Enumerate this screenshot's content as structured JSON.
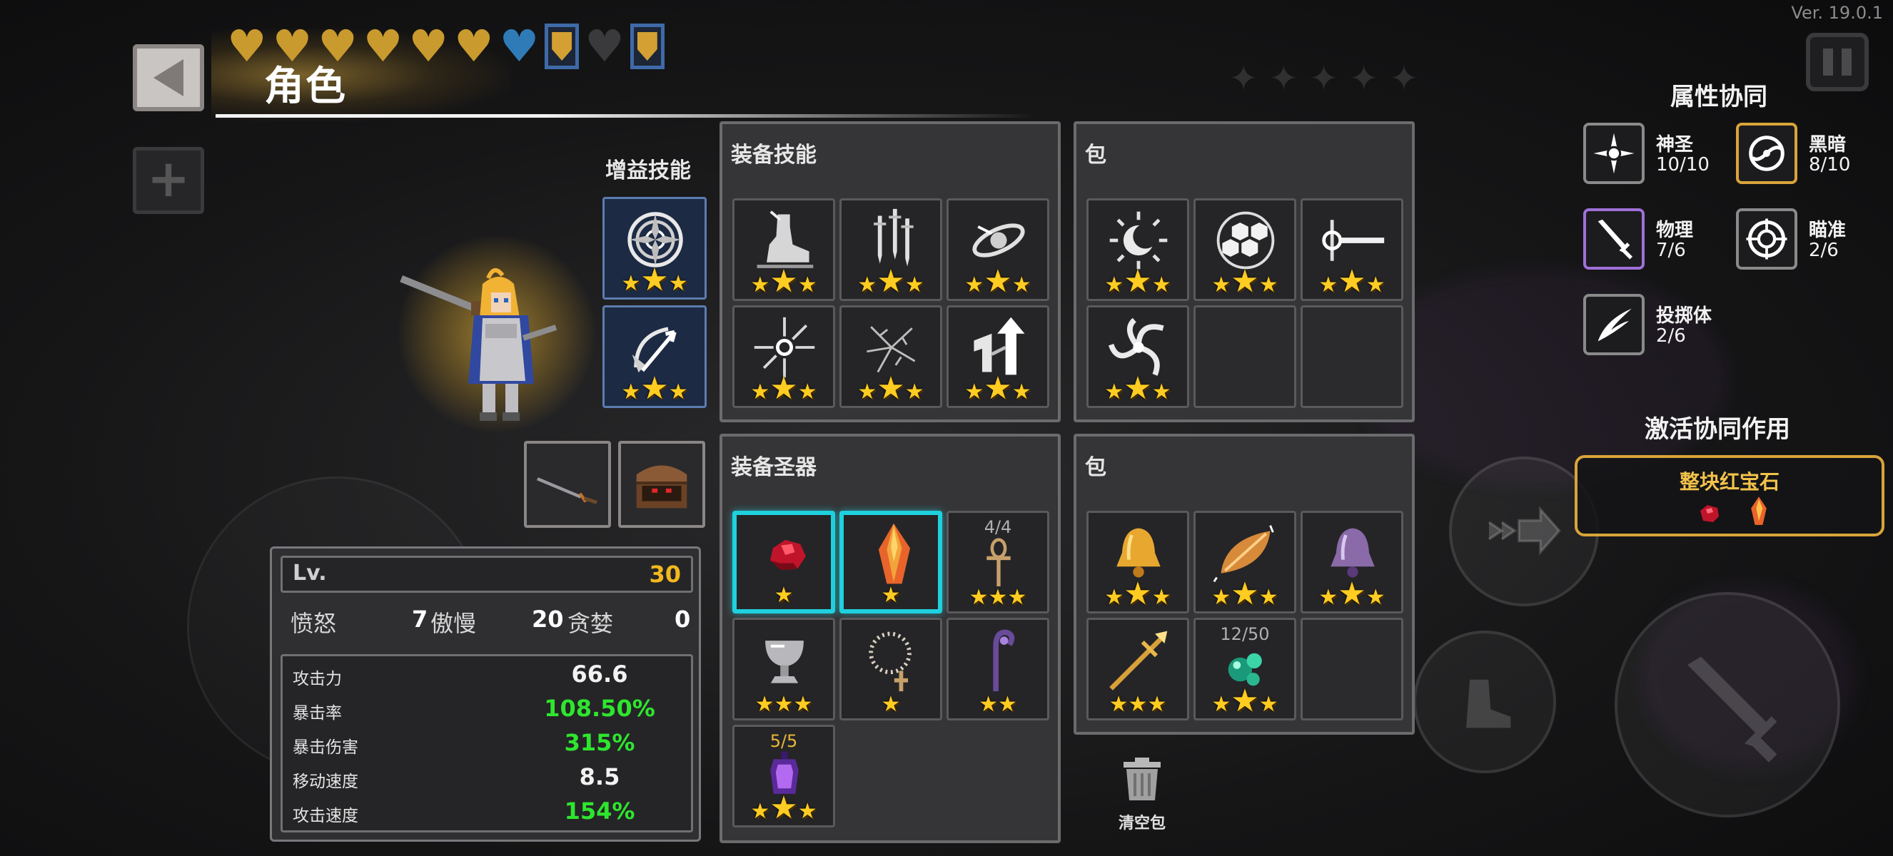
{
  "header": {
    "title": "角色",
    "version": "Ver. 19.0.1",
    "hearts": [
      {
        "type": "gold",
        "color": "#c99a2e"
      },
      {
        "type": "gold",
        "color": "#c99a2e"
      },
      {
        "type": "gold",
        "color": "#c99a2e"
      },
      {
        "type": "gold",
        "color": "#c99a2e"
      },
      {
        "type": "gold",
        "color": "#c99a2e"
      },
      {
        "type": "gold",
        "color": "#c99a2e"
      },
      {
        "type": "blue",
        "color": "#2f7bb8"
      },
      {
        "type": "shield"
      },
      {
        "type": "dark",
        "color": "#3a3a3c"
      },
      {
        "type": "shield"
      }
    ]
  },
  "buff_skills": {
    "label": "增益技能",
    "slots": [
      {
        "icon": "mandala-icon",
        "stars": 3
      },
      {
        "icon": "arrow-bow-icon",
        "stars": 3
      }
    ]
  },
  "character": {
    "name_icon": "knight-hero",
    "weapons": [
      "sword-weapon-icon",
      "treasure-chest-icon"
    ]
  },
  "stats": {
    "level_label": "Lv.",
    "level_value": "30",
    "sins": [
      {
        "label": "愤怒",
        "value": "7"
      },
      {
        "label": "傲慢",
        "value": "20"
      },
      {
        "label": "贪婪",
        "value": "0"
      }
    ],
    "attributes": [
      {
        "label": "攻击力",
        "value": "66.6",
        "tone": "white"
      },
      {
        "label": "暴击率",
        "value": "108.50%",
        "tone": "green"
      },
      {
        "label": "暴击伤害",
        "value": "315%",
        "tone": "green"
      },
      {
        "label": "移动速度",
        "value": "8.5",
        "tone": "white"
      },
      {
        "label": "攻击速度",
        "value": "154%",
        "tone": "green"
      }
    ]
  },
  "equip_skills": {
    "title": "装备技能",
    "slots": [
      {
        "icon": "boot-stomp-icon",
        "stars": 3
      },
      {
        "icon": "triple-daggers-icon",
        "stars": 3
      },
      {
        "icon": "orbit-disc-icon",
        "stars": 3
      },
      {
        "icon": "spark-burst-icon",
        "stars": 3
      },
      {
        "icon": "crack-icon",
        "stars": 3
      },
      {
        "icon": "rising-arrows-icon",
        "stars": 3
      }
    ]
  },
  "skill_bag": {
    "title": "包",
    "slots": [
      {
        "icon": "sun-moon-icon",
        "stars": 3
      },
      {
        "icon": "hexagon-shield-icon",
        "stars": 3
      },
      {
        "icon": "lance-icon",
        "stars": 3
      },
      {
        "icon": "whirlwind-icon",
        "stars": 3
      },
      {
        "icon": "",
        "stars": 0
      },
      {
        "icon": "",
        "stars": 0
      }
    ]
  },
  "equip_relics": {
    "title": "装备圣器",
    "slots": [
      {
        "icon": "ruby-chunk-icon",
        "stars": 1,
        "highlight": true,
        "count": ""
      },
      {
        "icon": "amber-crystal-icon",
        "stars": 1,
        "highlight": true,
        "count": ""
      },
      {
        "icon": "ankh-icon",
        "stars": 3,
        "highlight": false,
        "count": "4/4"
      },
      {
        "icon": "chalice-icon",
        "stars": 3,
        "highlight": false,
        "count": ""
      },
      {
        "icon": "rosary-icon",
        "stars": 1,
        "highlight": false,
        "count": ""
      },
      {
        "icon": "crook-staff-icon",
        "stars": 2,
        "highlight": false,
        "count": ""
      },
      {
        "icon": "purple-lantern-icon",
        "stars": 3,
        "highlight": false,
        "count": "5/5"
      }
    ]
  },
  "relic_bag": {
    "title": "包",
    "slots": [
      {
        "icon": "golden-bell-icon",
        "stars": 3,
        "count": ""
      },
      {
        "icon": "amber-leaf-icon",
        "stars": 3,
        "count": ""
      },
      {
        "icon": "silver-bell-icon",
        "stars": 3,
        "count": ""
      },
      {
        "icon": "golden-spear-icon",
        "stars": 3,
        "count": ""
      },
      {
        "icon": "green-orbs-icon",
        "stars": 3,
        "count": "12/50"
      },
      {
        "icon": "",
        "stars": 0,
        "count": ""
      }
    ]
  },
  "trash": {
    "label": "清空包"
  },
  "synergy": {
    "title": "属性协同",
    "items": [
      {
        "name": "神圣",
        "count": "10/10",
        "icon": "holy-star-icon",
        "accent": "#8a8a8a"
      },
      {
        "name": "黑暗",
        "count": "8/10",
        "icon": "dark-vortex-icon",
        "accent": "#d9a43a"
      },
      {
        "name": "物理",
        "count": "7/6",
        "icon": "physical-sword-icon",
        "accent": "#a070d8"
      },
      {
        "name": "瞄准",
        "count": "2/6",
        "icon": "crosshair-icon",
        "accent": "#8a8a8a"
      },
      {
        "name": "投掷体",
        "count": "2/6",
        "icon": "projectile-slash-icon",
        "accent": "#8a8a8a"
      }
    ],
    "activate_title": "激活协同作用",
    "active": {
      "name": "整块红宝石",
      "icons": [
        "ruby-icon",
        "amber-gem-icon"
      ]
    }
  },
  "colors": {
    "star": "#ffcc22",
    "green_stat": "#2ee62e",
    "level": "#f2b81d",
    "highlight": "#1fd1de",
    "accent_gold": "#d9a43a"
  }
}
